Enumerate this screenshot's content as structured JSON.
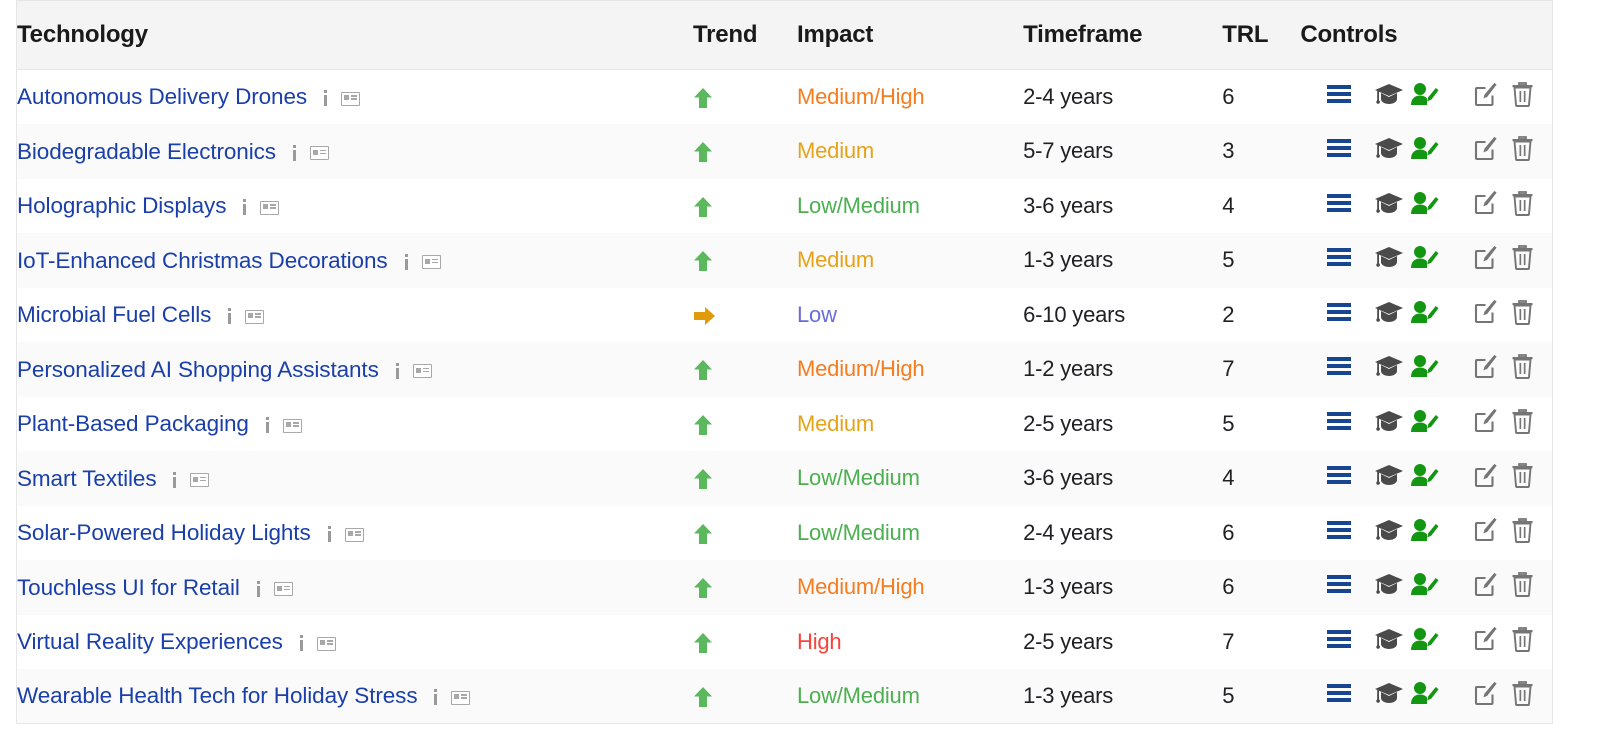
{
  "table": {
    "columns": [
      {
        "key": "technology",
        "label": "Technology"
      },
      {
        "key": "trend",
        "label": "Trend"
      },
      {
        "key": "impact",
        "label": "Impact"
      },
      {
        "key": "timeframe",
        "label": "Timeframe"
      },
      {
        "key": "trl",
        "label": "TRL"
      },
      {
        "key": "controls",
        "label": "Controls"
      }
    ],
    "row_icons": {
      "info": "info-icon",
      "card": "id-card-icon"
    },
    "control_icons": [
      {
        "name": "list-lines-icon",
        "color": "#17458f"
      },
      {
        "name": "graduation-cap-icon",
        "color": "#4a4a4a"
      },
      {
        "name": "user-edit-icon",
        "color": "#139612"
      },
      {
        "name": "edit-square-pencil-icon",
        "color": "#757575"
      },
      {
        "name": "trash-icon",
        "color": "#757575"
      }
    ],
    "impact_colors": {
      "High": "#f9423a",
      "Medium/High": "#f57c1f",
      "Medium": "#e6a319",
      "Low/Medium": "#4caf50",
      "Low": "#6b6be0"
    },
    "trend_colors": {
      "up": "#5cb85c",
      "flat": "#e09b0a"
    },
    "rows": [
      {
        "technology": "Autonomous Delivery Drones",
        "trend": "up",
        "impact": "Medium/High",
        "timeframe": "2-4 years",
        "trl": "6"
      },
      {
        "technology": "Biodegradable Electronics",
        "trend": "up",
        "impact": "Medium",
        "timeframe": "5-7 years",
        "trl": "3"
      },
      {
        "technology": "Holographic Displays",
        "trend": "up",
        "impact": "Low/Medium",
        "timeframe": "3-6 years",
        "trl": "4"
      },
      {
        "technology": "IoT-Enhanced Christmas Decorations",
        "trend": "up",
        "impact": "Medium",
        "timeframe": "1-3 years",
        "trl": "5"
      },
      {
        "technology": "Microbial Fuel Cells",
        "trend": "flat",
        "impact": "Low",
        "timeframe": "6-10 years",
        "trl": "2"
      },
      {
        "technology": "Personalized AI Shopping Assistants",
        "trend": "up",
        "impact": "Medium/High",
        "timeframe": "1-2 years",
        "trl": "7"
      },
      {
        "technology": "Plant-Based Packaging",
        "trend": "up",
        "impact": "Medium",
        "timeframe": "2-5 years",
        "trl": "5"
      },
      {
        "technology": "Smart Textiles",
        "trend": "up",
        "impact": "Low/Medium",
        "timeframe": "3-6 years",
        "trl": "4"
      },
      {
        "technology": "Solar-Powered Holiday Lights",
        "trend": "up",
        "impact": "Low/Medium",
        "timeframe": "2-4 years",
        "trl": "6"
      },
      {
        "technology": "Touchless UI for Retail",
        "trend": "up",
        "impact": "Medium/High",
        "timeframe": "1-3 years",
        "trl": "6"
      },
      {
        "technology": "Virtual Reality Experiences",
        "trend": "up",
        "impact": "High",
        "timeframe": "2-5 years",
        "trl": "7"
      },
      {
        "technology": "Wearable Health Tech for Holiday Stress",
        "trend": "up",
        "impact": "Low/Medium",
        "timeframe": "1-3 years",
        "trl": "5"
      }
    ]
  }
}
